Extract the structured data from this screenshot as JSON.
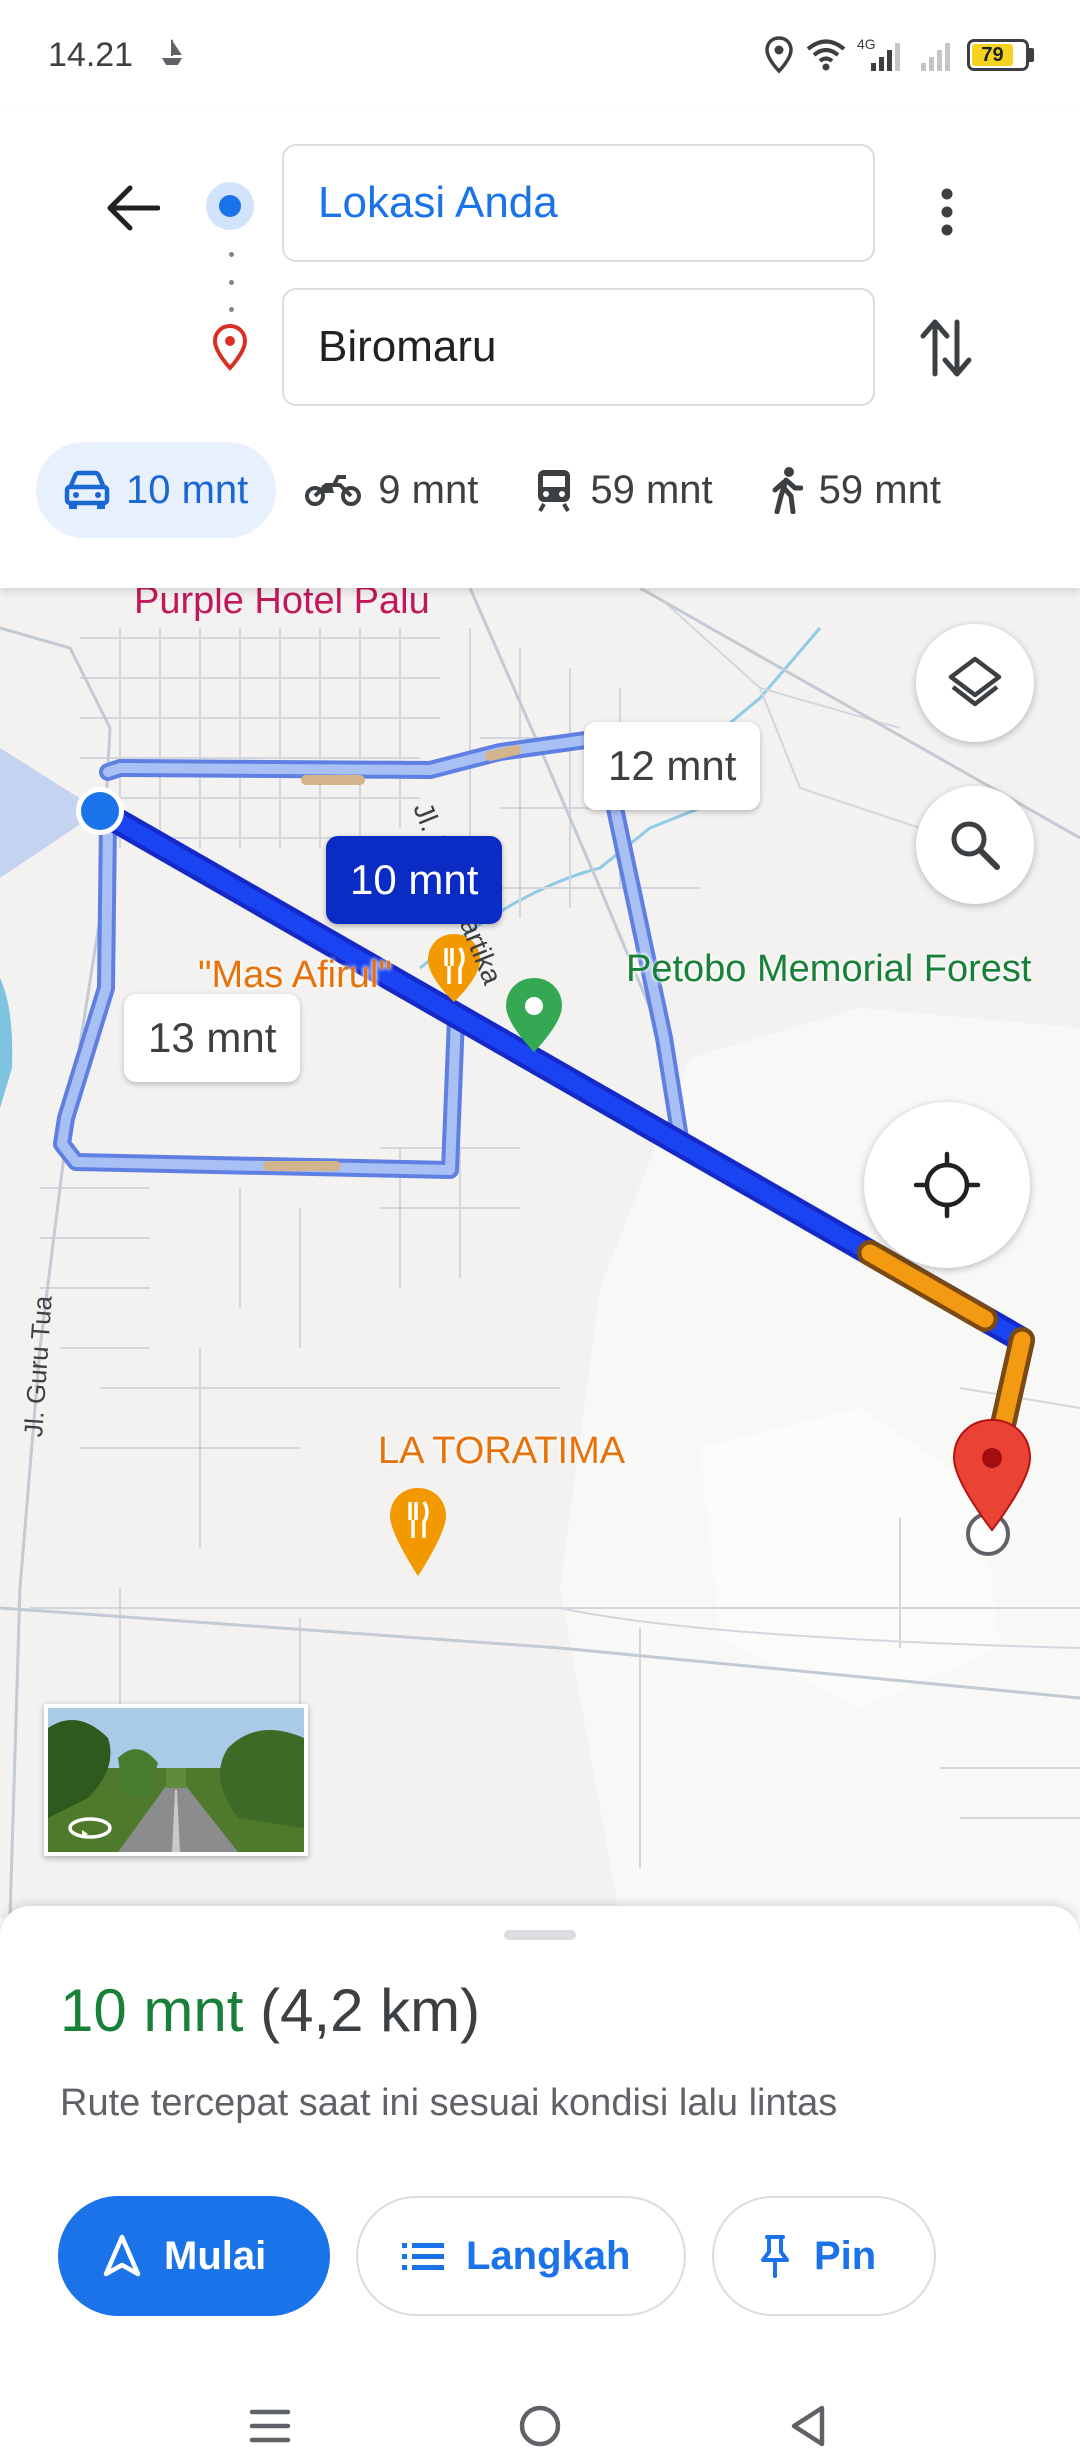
{
  "status_bar": {
    "time": "14.21",
    "network": "4G",
    "battery": "79"
  },
  "route_search": {
    "origin": "Lokasi Anda",
    "destination": "Biromaru"
  },
  "travel_modes": [
    {
      "mode": "car",
      "label": "10 mnt",
      "active": true
    },
    {
      "mode": "motorcycle",
      "label": "9 mnt"
    },
    {
      "mode": "transit",
      "label": "59 mnt"
    },
    {
      "mode": "walk",
      "label": "59 mnt"
    }
  ],
  "map": {
    "labels": {
      "hotel": "Purple Hotel Palu",
      "street_dewi": "Jl. Dewi Sartika",
      "restaurant_1": "\"Mas Afirul\"",
      "forest": "Petobo Memorial Forest",
      "street_guru": "Jl. Guru Tua",
      "restaurant_2": "LA TORATIMA"
    },
    "route_chips": {
      "selected": "10 mnt",
      "alt_1": "12 mnt",
      "alt_2": "13 mnt"
    },
    "colors": {
      "route_selected": "#1a3ff0",
      "route_alt": "#a7bff4",
      "traffic": "#f39a12",
      "destination": "#ea4335"
    }
  },
  "route_summary": {
    "duration": "10 mnt",
    "distance": "(4,2 km)",
    "description": "Rute tercepat saat ini sesuai kondisi lalu lintas"
  },
  "actions": {
    "start": "Mulai",
    "steps": "Langkah",
    "pin": "Pin"
  }
}
